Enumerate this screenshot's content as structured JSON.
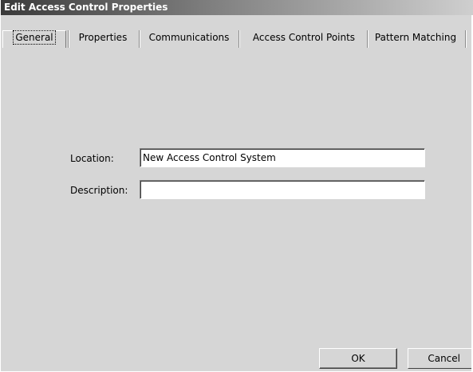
{
  "window": {
    "title": "Edit Access Control Properties"
  },
  "tabs": [
    {
      "label": "General",
      "active": true
    },
    {
      "label": "Properties",
      "active": false
    },
    {
      "label": "Communications",
      "active": false
    },
    {
      "label": "Access Control Points",
      "active": false
    },
    {
      "label": "Pattern Matching",
      "active": false
    }
  ],
  "form": {
    "location_label": "Location:",
    "location_value": "New Access Control System",
    "description_label": "Description:",
    "description_value": ""
  },
  "buttons": {
    "ok": "OK",
    "cancel": "Cancel"
  }
}
